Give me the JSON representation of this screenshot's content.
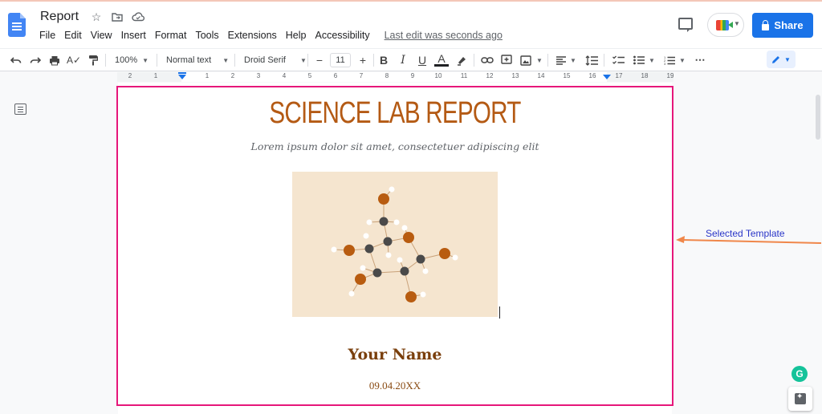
{
  "app": {
    "doc_title": "Report",
    "last_edit": "Last edit was seconds ago",
    "share_label": "Share"
  },
  "menu": [
    "File",
    "Edit",
    "View",
    "Insert",
    "Format",
    "Tools",
    "Extensions",
    "Help",
    "Accessibility"
  ],
  "toolbar": {
    "zoom": "100%",
    "style": "Normal text",
    "font": "Droid Serif",
    "font_size": "11",
    "minus": "−",
    "plus": "+",
    "bold": "B",
    "italic": "I",
    "underline": "U",
    "text_color": "A"
  },
  "ruler": {
    "ticks": [
      "2",
      "1",
      "1",
      "2",
      "3",
      "4",
      "5",
      "6",
      "7",
      "8",
      "9",
      "10",
      "11",
      "12",
      "13",
      "14",
      "15",
      "16",
      "17",
      "18",
      "19"
    ]
  },
  "document": {
    "title": "SCIENCE LAB REPORT",
    "subtitle": "Lorem ipsum dolor sit amet, consectetuer adipiscing elit",
    "name": "Your Name",
    "date": "09.04.20XX"
  },
  "annotation": {
    "label": "Selected Template"
  },
  "grammarly_label": "G",
  "colors": {
    "accent": "#1a73e8",
    "title": "#b45a14",
    "selection": "#e6177a",
    "annotation_arrow": "#f0874a",
    "molecule_bg": "#f5e5cf",
    "atom_orange": "#b85c10",
    "atom_dark": "#4a4a4a"
  },
  "icons": {
    "undo": "undo-icon",
    "redo": "redo-icon",
    "print": "print-icon",
    "spellcheck": "spellcheck-icon",
    "paint": "paint-format-icon",
    "highlight": "highlight-icon",
    "link": "link-icon",
    "comment": "add-comment-icon",
    "image": "insert-image-icon",
    "align": "align-icon",
    "line_spacing": "line-spacing-icon",
    "checklist": "checklist-icon",
    "bullets": "bulleted-list-icon",
    "numbered": "numbered-list-icon",
    "more": "more-icon",
    "edit_mode": "pencil-icon"
  }
}
